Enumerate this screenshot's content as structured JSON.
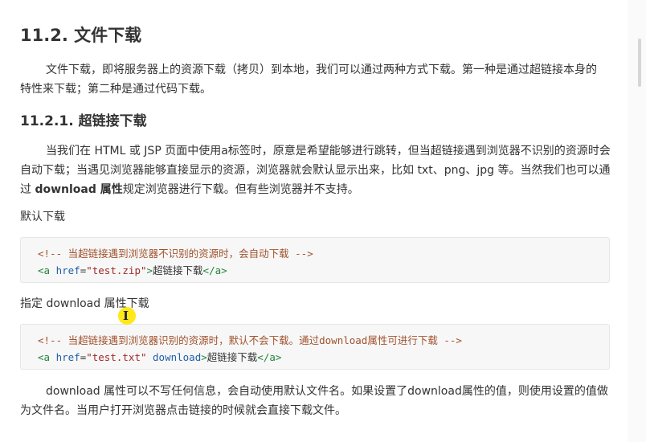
{
  "section": {
    "number": "11.2.",
    "title": "文件下载"
  },
  "intro": "文件下载，即将服务器上的资源下载（拷贝）到本地，我们可以通过两种方式下载。第一种是通过超链接本身的特性来下载；第二种是通过代码下载。",
  "subsection": {
    "number": "11.2.1.",
    "title": "超链接下载"
  },
  "para2": {
    "before": "当我们在 HTML 或 JSP 页面中使用a标签时，原意是希望能够进行跳转，但当超链接遇到浏览器不识别的资源时会自动下载；当遇见浏览器能够直接显示的资源，浏览器就会默认显示出来，比如 txt、png、jpg 等。当然我们也可以通过 ",
    "bold": "download 属性",
    "after": "规定浏览器进行下载。但有些浏览器并不支持。"
  },
  "label_default": "默认下载",
  "code1": {
    "comment": "<!-- 当超链接遇到浏览器不识别的资源时，会自动下载 -->",
    "open": "<a",
    "attr": "href",
    "eq": "=",
    "value": "\"test.zip\"",
    "text": "超链接下载",
    "close": "</a>"
  },
  "label_download": "指定 download 属性下载",
  "code2": {
    "comment": "<!-- 当超链接遇到浏览器识别的资源时，默认不会下载。通过download属性可进行下载 -->",
    "open": "<a",
    "attr": "href",
    "eq": "=",
    "value": "\"test.txt\"",
    "attr2": "download",
    "text": "超链接下载",
    "close": "</a>"
  },
  "para3": "download 属性可以不写任何信息，会自动使用默认文件名。如果设置了download属性的值，则使用设置的值做为文件名。当用户打开浏览器点击链接的时候就会直接下载文件。"
}
